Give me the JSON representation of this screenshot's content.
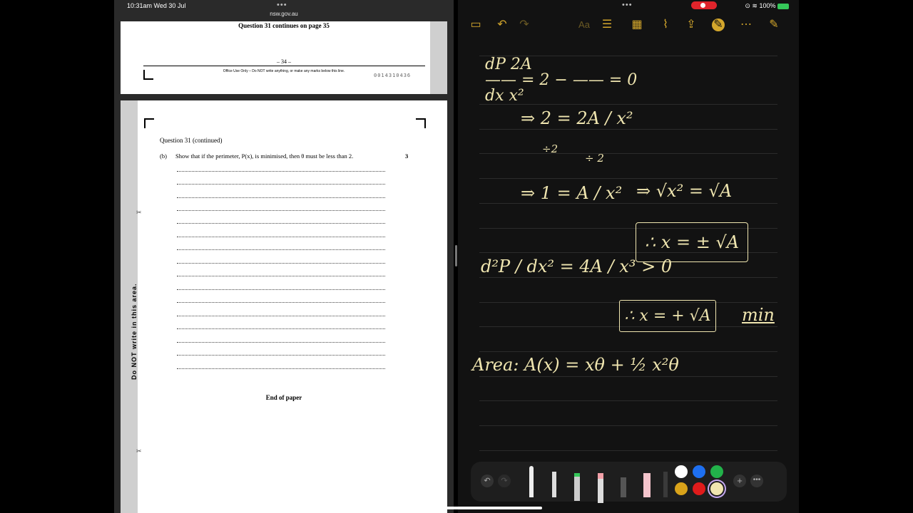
{
  "status_bar": {
    "time_date": "10:31am   Wed 30 Jul",
    "battery": "100%"
  },
  "left_pane": {
    "url": "nsw.gov.au",
    "page1": {
      "continues": "Question 31 continues on page 35",
      "page_number": "– 34 –",
      "office_use": "Office Use Only – Do NOT write anything, or make any marks below this line.",
      "barcode_number": "0014310436"
    },
    "page2": {
      "heading": "Question 31 (continued)",
      "part_label": "(b)",
      "question_text": "Show that if the perimeter, P(x), is minimised, then θ must be less than 2.",
      "marks": "3",
      "margin_text": "Do NOT write in this area.",
      "end": "End of paper"
    }
  },
  "right_pane": {
    "handwriting": {
      "l1": "dP   2A",
      "l1b": "—— = 2 − —— = 0",
      "l1c": "dx    x²",
      "l2": "⇒ 2 = 2A / x²",
      "l2a": "÷2",
      "l2b": "÷ 2",
      "l3": "⇒ 1 = A / x²",
      "l3b": "⇒ √x² = √A",
      "box1": "∴ x = ± √A",
      "l4": "d²P / dx² = 4A / x³  > 0",
      "box2": "∴ x = + √A",
      "min": "min",
      "area": "Area:  A(x) = xθ + ½ x²θ"
    },
    "toolbar_icons": [
      "sidebar-icon",
      "undo-icon",
      "redo-icon",
      "text-format-icon",
      "checklist-icon",
      "table-icon",
      "attachment-icon",
      "share-icon",
      "markup-icon",
      "more-icon",
      "compose-icon"
    ],
    "swatch_colors": [
      "#ffffff",
      "#1e6ff0",
      "#22b24a",
      "#d9a31a",
      "#e01b1b",
      "#f0e6b0"
    ]
  }
}
